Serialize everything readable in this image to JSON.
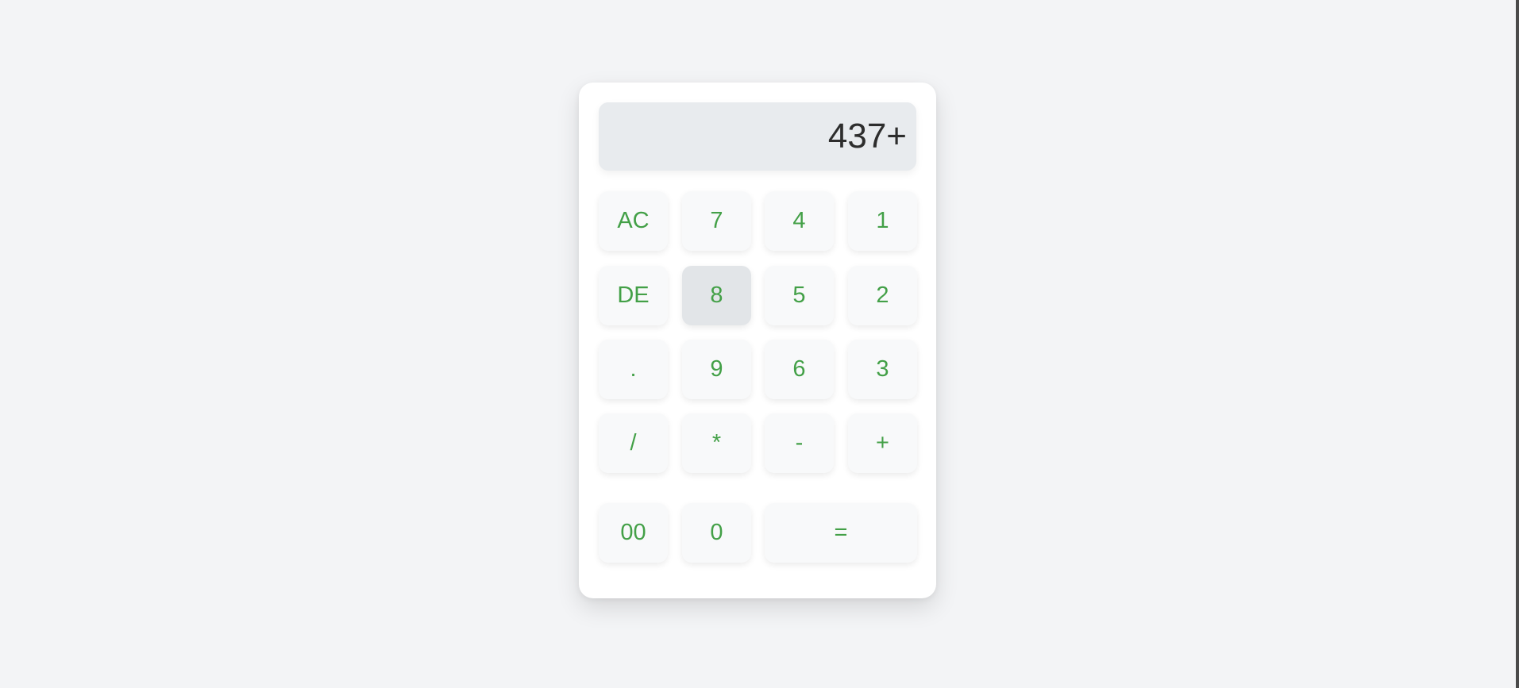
{
  "display": {
    "value": "437+"
  },
  "keys": {
    "ac": "AC",
    "seven": "7",
    "four": "4",
    "one": "1",
    "de": "DE",
    "eight": "8",
    "five": "5",
    "two": "2",
    "dot": ".",
    "nine": "9",
    "six": "6",
    "three": "3",
    "divide": "/",
    "multiply": "*",
    "subtract": "-",
    "add": "+",
    "double_zero": "00",
    "zero": "0",
    "equals": "="
  },
  "colors": {
    "key_text": "#43a047",
    "background": "#f3f4f6",
    "display_bg": "#e8ebee"
  }
}
